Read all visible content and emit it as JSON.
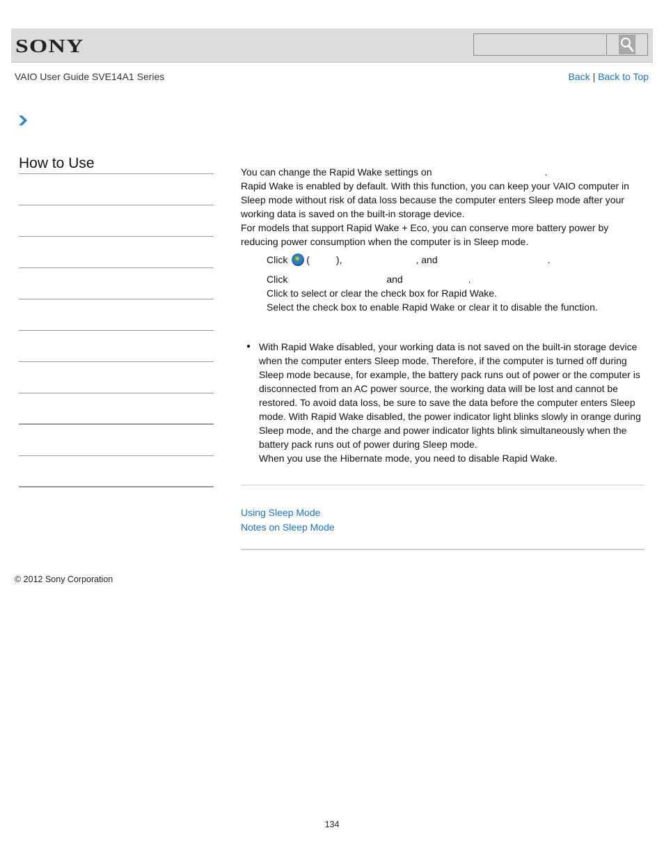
{
  "header": {
    "logo": "SONY",
    "search": {
      "placeholder": "",
      "value": ""
    },
    "search_icon": "magnifier-icon"
  },
  "subheader": {
    "guide_title": "VAIO User Guide SVE14A1 Series",
    "back_label": "Back",
    "separator": "|",
    "back_to_top_label": "Back to Top"
  },
  "breadcrumb": {
    "icon": "chevron-right-icon"
  },
  "sidebar": {
    "title": "How to Use",
    "items": [
      "",
      "",
      "",
      "",
      "",
      "",
      "",
      "",
      "",
      ""
    ]
  },
  "main": {
    "intro": [
      "You can change the Rapid Wake settings on",
      "Rapid Wake is enabled by default. With this function, you can keep your VAIO computer in Sleep mode without risk of data loss because the computer enters Sleep mode after your working data is saved on the built-in storage device.",
      "For models that support Rapid Wake + Eco, you can conserve more battery power by reducing power consumption when the computer is in Sleep mode."
    ],
    "steps": {
      "step1_click": "Click",
      "step1_paren_open": "(",
      "step1_paren_close": "),",
      "step1_and": ", and",
      "step1_end": ".",
      "step2_click": "Click",
      "step2_and": "and",
      "step2_end": ".",
      "step3": "Click to select or clear the check box for Rapid Wake.",
      "step3_detail": "Select the check box to enable Rapid Wake or clear it to disable the function."
    },
    "notes": [
      "With Rapid Wake disabled, your working data is not saved on the built-in storage device when the computer enters Sleep mode. Therefore, if the computer is turned off during Sleep mode because, for example, the battery pack runs out of power or the computer is disconnected from an AC power source, the working data will be lost and cannot be restored. To avoid data loss, be sure to save the data before the computer enters Sleep mode. With Rapid Wake disabled, the power indicator light blinks slowly in orange during Sleep mode, and the charge and power indicator lights blink simultaneously when the battery pack runs out of power during Sleep mode.",
      "When you use the Hibernate mode, you need to disable Rapid Wake."
    ]
  },
  "related_links": [
    "Using Sleep Mode",
    "Notes on Sleep Mode"
  ],
  "footer": {
    "copyright": "© 2012 Sony Corporation",
    "page_number": "134"
  },
  "colors": {
    "link": "#1a73c6",
    "header_bg": "#dcdcdc",
    "chevron": "#2a86d1"
  }
}
